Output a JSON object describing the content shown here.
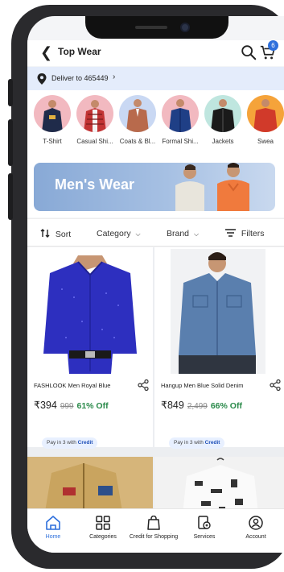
{
  "header": {
    "title": "Top Wear",
    "cart_count": "6"
  },
  "delivery": {
    "text": "Deliver to 465449"
  },
  "categories": [
    {
      "label": "T-Shirt",
      "bg": "#f2b9c0"
    },
    {
      "label": "Casual Shi...",
      "bg": "#f2b9c0"
    },
    {
      "label": "Coats & Bl...",
      "bg": "#c9d8f3"
    },
    {
      "label": "Formal Shi...",
      "bg": "#f2b9c0"
    },
    {
      "label": "Jackets",
      "bg": "#bfe6df"
    },
    {
      "label": "Swea",
      "bg": "#f5a33a"
    }
  ],
  "banner": {
    "text": "Men's Wear"
  },
  "filters": {
    "sort": "Sort",
    "category": "Category",
    "brand": "Brand",
    "filters": "Filters"
  },
  "products": [
    {
      "name": "FASHLOOK Men Royal Blue",
      "price": "₹394",
      "mrp": "999",
      "off": "61% Off",
      "credit_prefix": "Pay in 3 with",
      "credit_brand": "Credit"
    },
    {
      "name": "Hangup Men Blue Solid Denim",
      "price": "₹849",
      "mrp": "2,499",
      "off": "66% Off",
      "credit_prefix": "Pay in 3 with",
      "credit_brand": "Credit"
    }
  ],
  "nav": [
    {
      "label": "Home",
      "icon": "home-icon",
      "active": true
    },
    {
      "label": "Categories",
      "icon": "categories-icon",
      "active": false
    },
    {
      "label": "Credit for Shopping",
      "icon": "shopping-bag-icon",
      "active": false
    },
    {
      "label": "Services",
      "icon": "services-icon",
      "active": false
    },
    {
      "label": "Account",
      "icon": "account-icon",
      "active": false
    }
  ],
  "colors": {
    "accent": "#2d6fdc",
    "discount": "#2a8a4a",
    "delivery_bg": "#e4ecfb"
  }
}
